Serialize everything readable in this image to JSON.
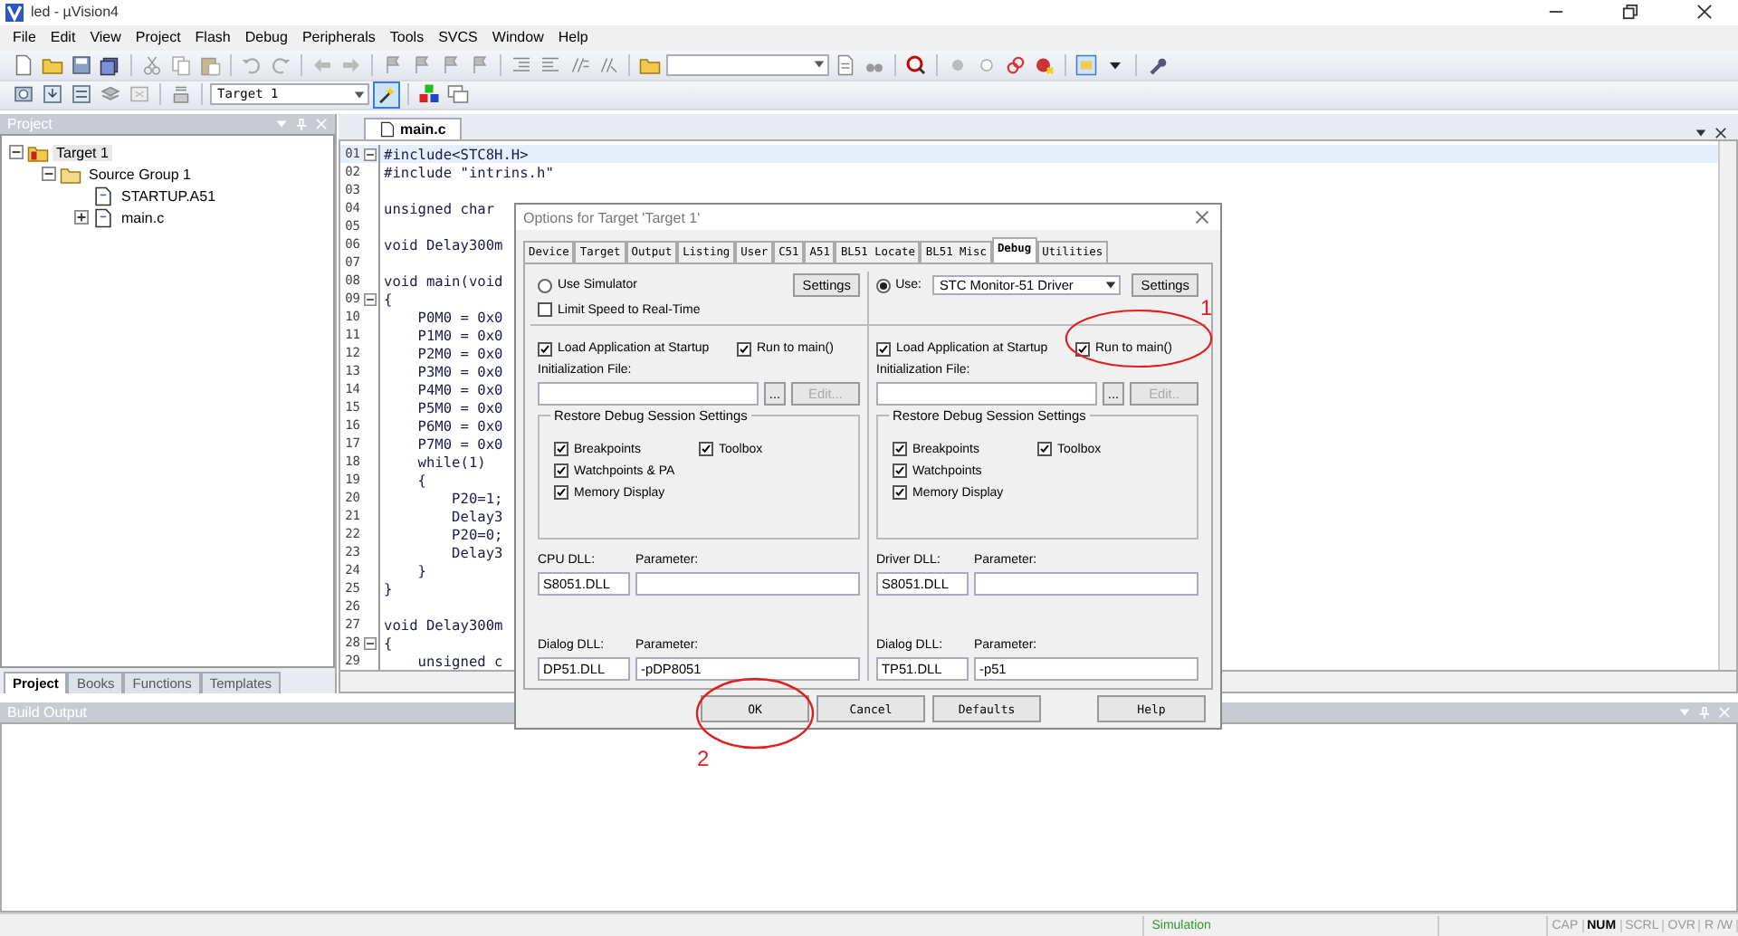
{
  "window": {
    "title": "led  - µVision4"
  },
  "menu": [
    "File",
    "Edit",
    "View",
    "Project",
    "Flash",
    "Debug",
    "Peripherals",
    "Tools",
    "SVCS",
    "Window",
    "Help"
  ],
  "target_select": {
    "value": "Target 1"
  },
  "project_panel": {
    "title": "Project",
    "tree": [
      {
        "label": "Target 1",
        "expanded": true,
        "selected": true,
        "children": [
          {
            "label": "Source Group 1",
            "expanded": true,
            "selected": false,
            "children": [
              {
                "label": "STARTUP.A51",
                "expanded": false,
                "selected": false
              },
              {
                "label": "main.c",
                "expanded": false,
                "selected": false,
                "collapsed_children": true
              }
            ]
          }
        ]
      }
    ],
    "tabs": [
      {
        "label": "Project",
        "selected": true
      },
      {
        "label": "Books",
        "selected": false
      },
      {
        "label": "Functions",
        "selected": false
      },
      {
        "label": "Templates",
        "selected": false
      }
    ]
  },
  "editor": {
    "tabs": [
      {
        "label": "main.c",
        "selected": true
      }
    ],
    "lines": [
      {
        "number": "01",
        "code": "#include<STC8H.H>",
        "current": true,
        "fold": true
      },
      {
        "number": "02",
        "code": "#include \"intrins.h\"",
        "current": false,
        "fold": false
      },
      {
        "number": "03",
        "current": false,
        "fold": false
      },
      {
        "number": "04",
        "code": "unsigned char",
        "current": false,
        "fold": false
      },
      {
        "number": "05",
        "current": false,
        "fold": false
      },
      {
        "number": "06",
        "code": "void Delay300m",
        "current": false,
        "fold": false
      },
      {
        "number": "07",
        "current": false,
        "fold": false
      },
      {
        "number": "08",
        "code": "void main(void",
        "current": false,
        "fold": false
      },
      {
        "number": "09",
        "code": "{",
        "current": false,
        "fold": true
      },
      {
        "number": "10",
        "code": "    P0M0 = 0x0",
        "current": false,
        "fold": false
      },
      {
        "number": "11",
        "code": "    P1M0 = 0x0",
        "current": false,
        "fold": false
      },
      {
        "number": "12",
        "code": "    P2M0 = 0x0",
        "current": false,
        "fold": false
      },
      {
        "number": "13",
        "code": "    P3M0 = 0x0",
        "current": false,
        "fold": false
      },
      {
        "number": "14",
        "code": "    P4M0 = 0x0",
        "current": false,
        "fold": false
      },
      {
        "number": "15",
        "code": "    P5M0 = 0x0",
        "current": false,
        "fold": false
      },
      {
        "number": "16",
        "code": "    P6M0 = 0x0",
        "current": false,
        "fold": false
      },
      {
        "number": "17",
        "code": "    P7M0 = 0x0",
        "current": false,
        "fold": false
      },
      {
        "number": "18",
        "code": "    while(1)",
        "current": false,
        "fold": false
      },
      {
        "number": "19",
        "code": "    {",
        "current": false,
        "fold": false
      },
      {
        "number": "20",
        "code": "        P20=1;",
        "current": false,
        "fold": false
      },
      {
        "number": "21",
        "code": "        Delay3",
        "current": false,
        "fold": false
      },
      {
        "number": "22",
        "code": "        P20=0;",
        "current": false,
        "fold": false
      },
      {
        "number": "23",
        "code": "        Delay3",
        "current": false,
        "fold": false
      },
      {
        "number": "24",
        "code": "    }",
        "current": false,
        "fold": false
      },
      {
        "number": "25",
        "code": "}",
        "current": false,
        "fold": false
      },
      {
        "number": "26",
        "current": false,
        "fold": false
      },
      {
        "number": "27",
        "code": "void Delay300m",
        "current": false,
        "fold": false
      },
      {
        "number": "28",
        "code": "{",
        "current": false,
        "fold": true
      },
      {
        "number": "29",
        "code": "    unsigned c",
        "current": false,
        "fold": false
      }
    ]
  },
  "build_output": {
    "title": "Build Output"
  },
  "status_bar": {
    "mode": "Simulation",
    "indicators": [
      {
        "label": "CAP",
        "on": false
      },
      {
        "label": "NUM",
        "on": true
      },
      {
        "label": "SCRL",
        "on": false
      },
      {
        "label": "OVR",
        "on": false
      },
      {
        "label": "R /W",
        "on": false
      }
    ]
  },
  "dialog": {
    "title": "Options for Target 'Target 1'",
    "tabs": [
      {
        "label": "Device",
        "selected": false
      },
      {
        "label": "Target",
        "selected": false
      },
      {
        "label": "Output",
        "selected": false
      },
      {
        "label": "Listing",
        "selected": false
      },
      {
        "label": "User",
        "selected": false
      },
      {
        "label": "C51",
        "selected": false
      },
      {
        "label": "A51",
        "selected": false
      },
      {
        "label": "BL51 Locate",
        "selected": false
      },
      {
        "label": "BL51 Misc",
        "selected": false
      },
      {
        "label": "Debug",
        "selected": true
      },
      {
        "label": "Utilities",
        "selected": false
      }
    ],
    "columns": [
      {
        "use": {
          "label": "Use Simulator",
          "selected": false
        },
        "settings": "Settings",
        "limit_speed": {
          "label": "Limit Speed to Real-Time",
          "checked": false
        },
        "load_app": {
          "label": "Load Application at Startup",
          "checked": true
        },
        "run_to_main": {
          "label": "Run to main()",
          "checked": true
        },
        "init_file": {
          "label": "Initialization File:",
          "browse": "...",
          "edit": {
            "label": "Edit...",
            "disabled": true
          }
        },
        "restore": {
          "title": "Restore Debug Session Settings",
          "columns": [
            [
              {
                "label": "Breakpoints",
                "checked": true
              },
              {
                "label": "Watchpoints & PA",
                "checked": true
              },
              {
                "label": "Memory Display",
                "checked": true
              }
            ],
            [
              {
                "label": "Toolbox",
                "checked": true
              }
            ]
          ]
        },
        "dll": {
          "label": "CPU DLL:",
          "value": "S8051.DLL",
          "param_label": "Parameter:"
        },
        "dialog_dll": {
          "label": "Dialog DLL:",
          "value": "DP51.DLL",
          "param_label": "Parameter:",
          "param": "-pDP8051"
        }
      },
      {
        "use": {
          "label": "Use:",
          "selected": true
        },
        "driver": "STC Monitor-51 Driver",
        "settings": "Settings",
        "load_app": {
          "label": "Load Application at Startup",
          "checked": true
        },
        "run_to_main": {
          "label": "Run to main()",
          "checked": true
        },
        "init_file": {
          "label": "Initialization File:",
          "browse": "...",
          "edit": {
            "label": "Edit..",
            "disabled": true
          }
        },
        "restore": {
          "title": "Restore Debug Session Settings",
          "columns": [
            [
              {
                "label": "Breakpoints",
                "checked": true
              },
              {
                "label": "Watchpoints",
                "checked": true
              },
              {
                "label": "Memory Display",
                "checked": true
              }
            ],
            [
              {
                "label": "Toolbox",
                "checked": true
              }
            ]
          ]
        },
        "dll": {
          "label": "Driver DLL:",
          "value": "S8051.DLL",
          "param_label": "Parameter:"
        },
        "dialog_dll": {
          "label": "Dialog DLL:",
          "value": "TP51.DLL",
          "param_label": "Parameter:",
          "param": "-p51"
        }
      }
    ],
    "buttons": [
      "OK",
      "Cancel",
      "Defaults",
      "Help"
    ]
  },
  "annotations": [
    {
      "label": "1"
    },
    {
      "label": "2"
    }
  ]
}
